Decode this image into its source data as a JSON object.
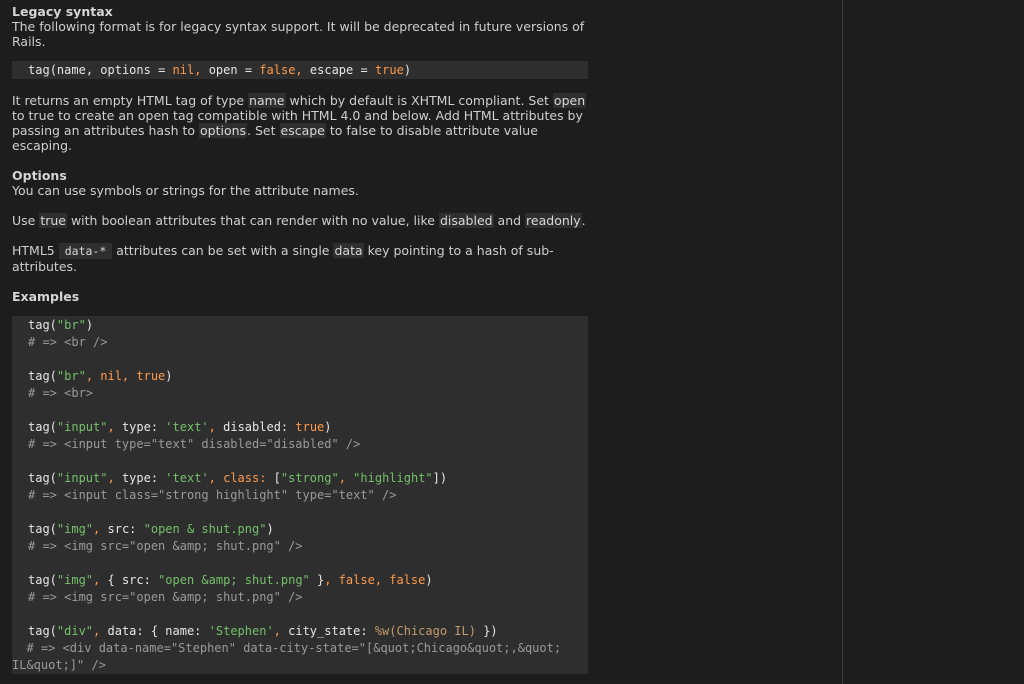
{
  "legacy": {
    "heading": "Legacy syntax",
    "intro": "The following format is for legacy syntax support. It will be deprecated in future versions of Rails.",
    "signature": {
      "fn": "tag",
      "p1": "name",
      "p2": "options",
      "d2": "nil",
      "p3": "open",
      "d3": "false",
      "p4": "escape",
      "d4": "true"
    }
  },
  "description": {
    "t1": "It returns an empty HTML tag of type ",
    "c1": "name",
    "t2": " which by default is XHTML compliant. Set ",
    "c2": "open",
    "t3": " to true to create an open tag compatible with HTML 4.0 and below. Add HTML attributes by passing an attributes hash to ",
    "c3": "options",
    "t4": ". Set ",
    "c4": "escape",
    "t5": " to false to disable attribute value escaping."
  },
  "options": {
    "heading": "Options",
    "line1": "You can use symbols or strings for the attribute names.",
    "use_a": "Use ",
    "use_c1": "true",
    "use_b": " with boolean attributes that can render with no value, like ",
    "use_c2": "disabled",
    "use_d": " and ",
    "use_c3": "readonly",
    "use_e": ".",
    "h5_a": "HTML5 ",
    "h5_c1": "data-*",
    "h5_b": " attributes can be set with a single ",
    "h5_c2": "data",
    "h5_c": " key pointing to a hash of sub-attributes."
  },
  "examples": {
    "heading": "Examples",
    "comments": [
      "# => <br />",
      "# => <br>",
      "# => <input type=\"text\" disabled=\"disabled\" />",
      "# => <input class=\"strong highlight\" type=\"text\" />",
      "# => <img src=\"open &amp; shut.png\" />",
      "# => <img src=\"open &amp; shut.png\" />",
      "  # => <div data-name=\"Stephen\" data-city-state=\"[&quot;Chicago&quot;,&quot;",
      "IL&quot;]\" />"
    ]
  }
}
